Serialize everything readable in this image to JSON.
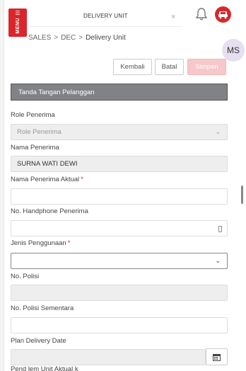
{
  "header": {
    "menu_label": "MENU",
    "tab_title": "DELIVERY UNIT",
    "tab_close": "×",
    "bell_icon": "bell-icon",
    "car_icon": "car-icon",
    "brand_color": "#d9262c"
  },
  "breadcrumb": {
    "items": [
      "SALES",
      "DEC",
      "Delivery Unit"
    ],
    "separator": ">"
  },
  "avatar": {
    "initials": "MS"
  },
  "toolbar": {
    "kembali_label": "Kembali",
    "batal_label": "Batal",
    "simpan_label": "Simpan"
  },
  "section": {
    "title": "Tanda Tangan Pelanggan"
  },
  "form": {
    "role_penerima": {
      "label": "Role Penerima",
      "placeholder": "Role Penerima"
    },
    "nama_penerima": {
      "label": "Nama Penerima",
      "value": "SURNA WATI DEWI"
    },
    "nama_penerima_aktual": {
      "label": "Nama Penerima Aktual",
      "required": "*",
      "value": ""
    },
    "no_handphone": {
      "label": "No. Handphone Penerima",
      "value": ""
    },
    "jenis_penggunaan": {
      "label": "Jenis Penggunaan",
      "required": "*",
      "value": ""
    },
    "no_polisi": {
      "label": "No. Polisi",
      "value": ""
    },
    "no_polisi_sementara": {
      "label": "No. Polisi Sementara",
      "value": ""
    },
    "plan_delivery_date": {
      "label": "Plan Delivery Date",
      "value": ""
    },
    "next_label_cutoff": "Pend lem  Unit Aktual k"
  }
}
